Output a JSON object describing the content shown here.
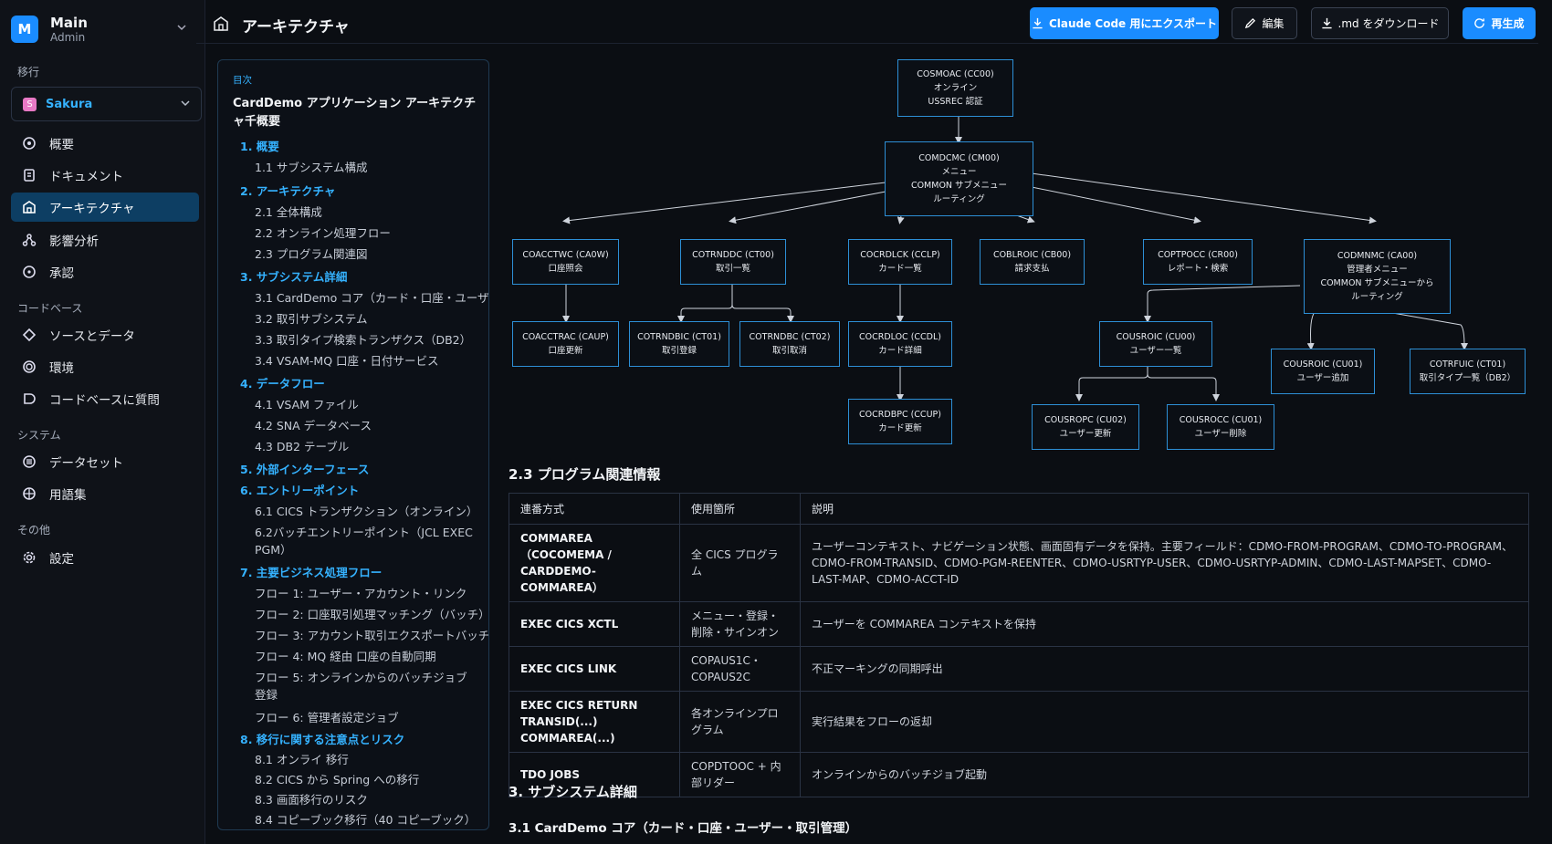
{
  "workspace": {
    "avatar": "M",
    "name": "Main",
    "role": "Admin"
  },
  "sidebar": {
    "sections": [
      "移行",
      "コードベース",
      "システム",
      "その他"
    ],
    "project": {
      "badge": "S",
      "name": "Sakura"
    },
    "items": [
      {
        "label": "概要",
        "icon": "overview-icon"
      },
      {
        "label": "ドキュメント",
        "icon": "document-icon"
      },
      {
        "label": "アーキテクチャ",
        "icon": "architecture-icon"
      },
      {
        "label": "影響分析",
        "icon": "impact-icon"
      },
      {
        "label": "承認",
        "icon": "approval-icon"
      },
      {
        "label": "ソースとデータ",
        "icon": "source-icon"
      },
      {
        "label": "環境",
        "icon": "environment-icon"
      },
      {
        "label": "コードベースに質問",
        "icon": "chat-icon"
      },
      {
        "label": "データセット",
        "icon": "dataset-icon"
      },
      {
        "label": "用語集",
        "icon": "glossary-icon"
      },
      {
        "label": "設定",
        "icon": "gear-icon"
      }
    ]
  },
  "header": {
    "title": "アーキテクチャ",
    "buttons": {
      "export": "Claude Code 用にエクスポート",
      "edit": "編集",
      "download": ".md をダウンロード",
      "regenerate": "再生成"
    }
  },
  "toc": {
    "label": "目次",
    "title": "CardDemo アプリケーション アーキテクチャ千概要",
    "items": [
      "1. 概要",
      "1.1 サブシステム構成",
      "2. アーキテクチャ",
      "2.1 全体構成",
      "2.2 オンライン処理フロー",
      "2.3 プログラム関連図",
      "3. サブシステム詳細",
      "3.1 CardDemo コア（カード・口座・ユーザ･",
      "3.2 取引サブシステム",
      "3.3 取引タイプ検索トランザクス（DB2）",
      "3.4 VSAM-MQ 口座・日付サービス",
      "4. データフロー",
      "4.1 VSAM ファイル",
      "4.2 SNA データベース",
      "4.3 DB2 テーブル",
      "5. 外部インターフェース",
      "6. エントリーポイント",
      "6.1 CICS トランザクション（オンライン）",
      "6.2バッチエントリーポイント（JCL EXEC PGM）",
      "7. 主要ビジネス処理フロー",
      "フロー 1: ユーザー・アカウント・リンク",
      "フロー 2: 口座取引処理マッチング（バッチ）",
      "フロー 3: アカウント取引エクスポートバッチ",
      "フロー 4: MQ 経由 口座の自動同期",
      "フロー 5: オンラインからのバッチジョブ登録",
      "フロー 6: 管理者設定ジョブ",
      "8. 移行に関する注意点とリスク",
      "8.1 オンライ 移行",
      "8.2 CICS から Spring への移行",
      "8.3 画面移行のリスク",
      "8.4 コピーブック移行（40 コピーブック）"
    ]
  },
  "diagram": {
    "nodes": [
      {
        "id": "cc00",
        "lines": [
          "COSMOAC (CC00)",
          "オンライン",
          "USSREC 認証"
        ]
      },
      {
        "id": "cm00",
        "lines": [
          "COMDCMC (CM00)",
          "メニュー",
          "COMMON サブメニュー",
          "ルーティング"
        ]
      },
      {
        "id": "ca0w",
        "lines": [
          "COACCTWC (CA0W)",
          "口座照会"
        ]
      },
      {
        "id": "ct00",
        "lines": [
          "COTRNDDC (CT00)",
          "取引一覧"
        ]
      },
      {
        "id": "cclp",
        "lines": [
          "COCRDLCK (CCLP)",
          "カード一覧"
        ]
      },
      {
        "id": "cb00",
        "lines": [
          "COBLROIC (CB00)",
          "請求支払"
        ]
      },
      {
        "id": "cr00",
        "lines": [
          "COPTPOCC (CR00)",
          "レポート・検索"
        ]
      },
      {
        "id": "ca00",
        "lines": [
          "CODMNMC (CA00)",
          "管理者メニュー",
          "COMMON サブメニューから",
          "ルーティング"
        ]
      },
      {
        "id": "caup",
        "lines": [
          "COACCTRAC (CAUP)",
          "口座更新"
        ]
      },
      {
        "id": "ct01",
        "lines": [
          "COTRNDBIC (CT01)",
          "取引登録"
        ]
      },
      {
        "id": "ct02",
        "lines": [
          "COTRNDBC (CT02)",
          "取引取消"
        ]
      },
      {
        "id": "ccdl",
        "lines": [
          "COCRDLOC (CCDL)",
          "カード詳細"
        ]
      },
      {
        "id": "cu00",
        "lines": [
          "COUSROIC (CU00)",
          "ユーザー一覧"
        ]
      },
      {
        "id": "cu01a",
        "lines": [
          "COUSROIC (CU01)",
          "ユーザー追加"
        ]
      },
      {
        "id": "ct01b",
        "lines": [
          "COTRFUIC (CT01)",
          "取引タイプ一覧（DB2）"
        ]
      },
      {
        "id": "ccup",
        "lines": [
          "COCRDBPC (CCUP)",
          "カード更新"
        ]
      },
      {
        "id": "cu02",
        "lines": [
          "COUSROPC (CU02)",
          "ユーザー更新"
        ]
      },
      {
        "id": "cu01",
        "lines": [
          "COUSROCC (CU01)",
          "ユーザー削除"
        ]
      }
    ]
  },
  "section": {
    "heading": "2.3 プログラム関連情報",
    "table": {
      "headers": [
        "連番方式",
        "使用箇所",
        "説明"
      ],
      "rows": [
        [
          "COMMAREA（COCOMEMA / CARDDEMO-COMMAREA）",
          "全 CICS プログラム",
          "ユーザーコンテキスト、ナビゲーション状態、画面固有データを保持。主要フィールド：CDMO-FROM-PROGRAM、CDMO-TO-PROGRAM、CDMO-FROM-TRANSID、CDMO-PGM-REENTER、CDMO-USRTYP-USER、CDMO-USRTYP-ADMIN、CDMO-LAST-MAPSET、CDMO-LAST-MAP、CDMO-ACCT-ID"
        ],
        [
          "EXEC CICS XCTL",
          "メニュー・登録・削除・サインオン",
          "ユーザーを COMMAREA コンテキストを保持"
        ],
        [
          "EXEC CICS LINK",
          "COPAUS1C・COPAUS2C",
          "不正マーキングの同期呼出"
        ],
        [
          "EXEC CICS RETURN TRANSID(...) COMMAREA(...)",
          "各オンラインプログラム",
          "実行結果をフローの返却"
        ],
        [
          "TDO JOBS",
          "COPDTOOC + 内部リダー",
          "オンラインからのバッチジョブ起動"
        ]
      ]
    }
  },
  "next": {
    "h3": "3. サブシステム詳細",
    "h4": "3.1 CardDemo コア（カード・口座・ユーザー・取引管理）"
  }
}
